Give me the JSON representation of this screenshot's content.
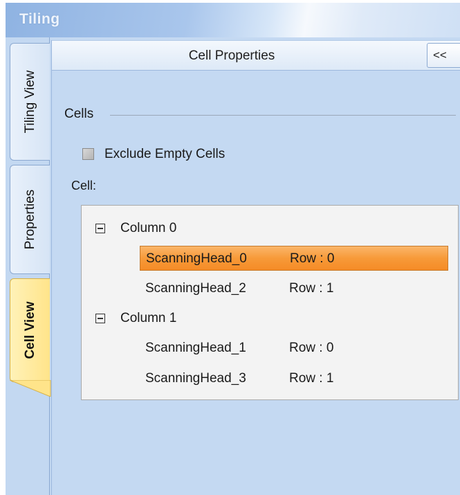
{
  "window": {
    "title": "Tiling"
  },
  "tabs": [
    {
      "label": "Tiling View",
      "active": false
    },
    {
      "label": "Properties",
      "active": false
    },
    {
      "label": "Cell View",
      "active": true
    }
  ],
  "panel": {
    "title": "Cell Properties",
    "collapse_label": "<<"
  },
  "cells_group": {
    "label": "Cells",
    "exclude_empty": {
      "label": "Exclude Empty Cells",
      "checked": false
    },
    "cell_label": "Cell:"
  },
  "tree": {
    "columns": [
      {
        "label": "Column  0",
        "expanded": true,
        "items": [
          {
            "name": "ScanningHead_0",
            "row": "Row : 0",
            "selected": true
          },
          {
            "name": "ScanningHead_2",
            "row": "Row : 1",
            "selected": false
          }
        ]
      },
      {
        "label": "Column  1",
        "expanded": true,
        "items": [
          {
            "name": "ScanningHead_1",
            "row": "Row : 0",
            "selected": false
          },
          {
            "name": "ScanningHead_3",
            "row": "Row : 1",
            "selected": false
          }
        ]
      }
    ]
  },
  "colors": {
    "selection": "#f79a39",
    "active_tab": "#ffe48a",
    "panel_bg": "#c4d9f2"
  },
  "icons": {
    "expander": "minus-box-icon"
  }
}
